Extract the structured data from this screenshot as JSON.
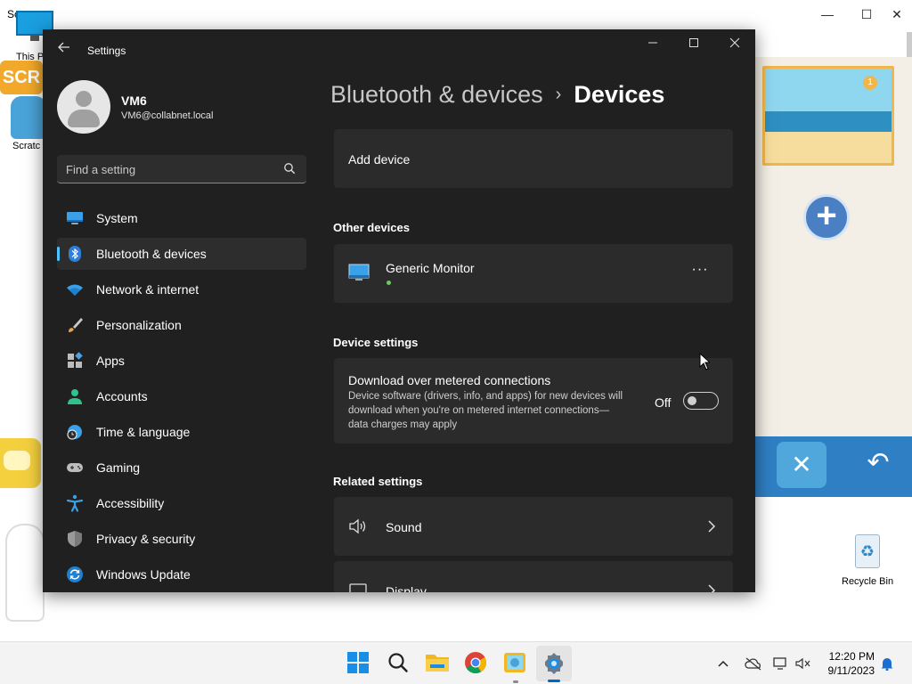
{
  "background_app": {
    "title": "Sc",
    "scene_badge": "1",
    "controls": {
      "minimize": "—",
      "maximize": "☐",
      "close": "✕"
    }
  },
  "desktop": {
    "this_pc_label": "This P",
    "scratch_label": "Scratc",
    "scratch_logo": "SCR",
    "recycle_bin_label": "Recycle Bin"
  },
  "settings": {
    "window_title": "Settings",
    "controls": {
      "minimize": "—",
      "maximize": "☐",
      "close": "✕"
    },
    "user": {
      "name": "VM6",
      "email": "VM6@collabnet.local"
    },
    "search": {
      "placeholder": "Find a setting"
    },
    "nav": [
      {
        "label": "System",
        "icon": "system-icon"
      },
      {
        "label": "Bluetooth & devices",
        "icon": "bluetooth-icon",
        "active": true
      },
      {
        "label": "Network & internet",
        "icon": "wifi-icon"
      },
      {
        "label": "Personalization",
        "icon": "brush-icon"
      },
      {
        "label": "Apps",
        "icon": "apps-icon"
      },
      {
        "label": "Accounts",
        "icon": "accounts-icon"
      },
      {
        "label": "Time & language",
        "icon": "globe-clock-icon"
      },
      {
        "label": "Gaming",
        "icon": "gamepad-icon"
      },
      {
        "label": "Accessibility",
        "icon": "accessibility-icon"
      },
      {
        "label": "Privacy & security",
        "icon": "shield-icon"
      },
      {
        "label": "Windows Update",
        "icon": "update-icon"
      }
    ],
    "breadcrumb": {
      "parent": "Bluetooth & devices",
      "separator": "›",
      "current": "Devices"
    },
    "add_device": {
      "label": "Add device"
    },
    "other_devices": {
      "title": "Other devices",
      "device": {
        "name": "Generic Monitor",
        "icon": "monitor-icon",
        "more": "···"
      }
    },
    "device_settings": {
      "title": "Device settings",
      "metered": {
        "title": "Download over metered connections",
        "description": "Device software (drivers, info, and apps) for new devices will download when you're on metered internet connections—data charges may apply",
        "state": "Off",
        "enabled": false
      }
    },
    "related_settings": {
      "title": "Related settings",
      "items": [
        {
          "label": "Sound",
          "icon": "speaker-icon"
        },
        {
          "label": "Display",
          "icon": "display-icon"
        }
      ]
    }
  },
  "taskbar": {
    "apps": [
      "start-icon",
      "search-icon",
      "file-explorer-icon",
      "chrome-icon",
      "scratch-icon",
      "settings-icon"
    ],
    "clock": {
      "time": "12:20 PM",
      "date": "9/11/2023"
    },
    "accent_color": "#0067c0"
  },
  "colors": {
    "window_bg": "#202020",
    "card_bg": "#2b2b2b",
    "accent": "#4cc2ff"
  }
}
